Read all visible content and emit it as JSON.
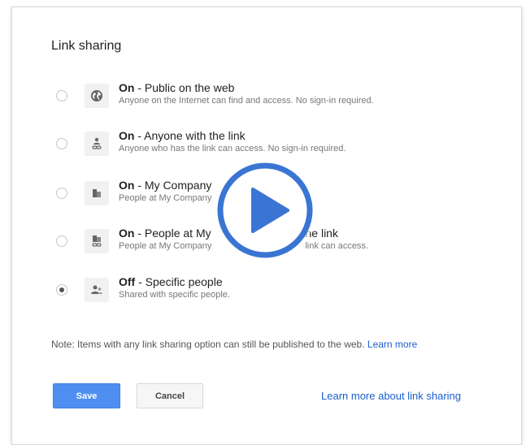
{
  "dialog": {
    "title": "Link sharing",
    "options": [
      {
        "status": "On",
        "label": " - Public on the web",
        "description": "Anyone on the Internet can find and access. No sign-in required.",
        "icon": "globe-icon",
        "selected": false
      },
      {
        "status": "On",
        "label": " - Anyone with the link",
        "description": "Anyone who has the link can access. No sign-in required.",
        "icon": "person-link-icon",
        "selected": false
      },
      {
        "status": "On",
        "label": " - My Company",
        "description": "People at My Company",
        "icon": "building-icon",
        "selected": false
      },
      {
        "status": "On",
        "label": " -  People at My",
        "label_tail": "the link",
        "description": "People at My Company",
        "description_tail": "link can access.",
        "icon": "building-link-icon",
        "selected": false
      },
      {
        "status": "Off",
        "label": " - Specific people",
        "description": "Shared with specific people.",
        "icon": "people-icon",
        "selected": true
      }
    ],
    "note": {
      "text": "Note: Items with any link sharing option can still be published to the web. ",
      "link": "Learn more"
    },
    "buttons": {
      "save": "Save",
      "cancel": "Cancel"
    },
    "learn_more_sharing": "Learn more about link sharing"
  },
  "overlay": {
    "icon": "play-icon",
    "color": "#3a75d3"
  },
  "colors": {
    "accent": "#4d8ef0",
    "link": "#1a5fcf"
  }
}
